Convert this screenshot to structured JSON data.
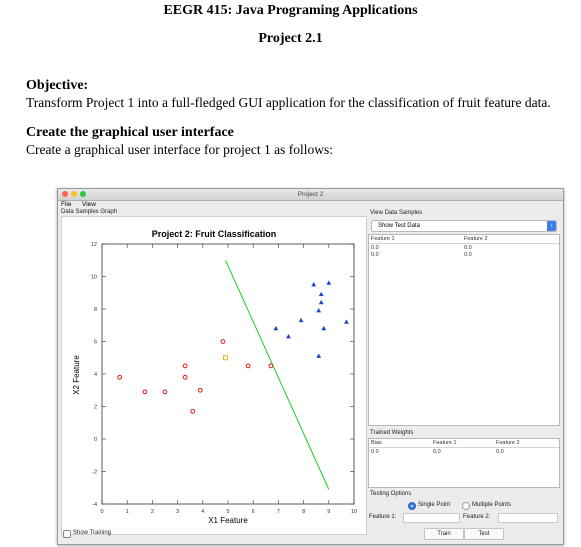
{
  "document": {
    "course_title": "EEGR 415: Java Programing Applications",
    "project_title": "Project 2.1",
    "objective_heading": "Objective:",
    "objective_text": "Transform Project 1 into a full-fledged GUI application for the classification of fruit feature data.",
    "gui_heading": "Create the graphical user interface",
    "gui_text": "Create a graphical user interface for project 1 as follows:"
  },
  "window": {
    "title": "Project 2",
    "menus": [
      "File",
      "View"
    ],
    "traffic_light_colors": [
      "#ff5f57",
      "#febc2e",
      "#28c840"
    ],
    "graph_panel_label": "Data Samples Graph",
    "view_panel_label": "View Data Samples",
    "view_select_value": "Show Test Data",
    "samples_table": {
      "headers": [
        "Feature 1",
        "Feature 2"
      ],
      "rows": [
        [
          "0.0",
          "0.0"
        ],
        [
          "0.0",
          "0.0"
        ]
      ]
    },
    "weights_label": "Trained Weights",
    "weights_table": {
      "headers": [
        "Bias",
        "Feature 1",
        "Feature 2"
      ],
      "rows": [
        [
          "0.0",
          "0.0",
          "0.0"
        ]
      ]
    },
    "testing_label": "Testing Options",
    "radio_single": "Single Point",
    "radio_multiple": "Multiple Points",
    "feature1_label": "Feature 1:",
    "feature2_label": "Feature 2:",
    "train_button": "Train",
    "test_button": "Test",
    "show_training_label": "Show Training"
  },
  "chart_data": {
    "type": "scatter",
    "title": "Project 2: Fruit Classification",
    "xlabel": "X1 Feature",
    "ylabel": "X2 Feature",
    "xlim": [
      0,
      10
    ],
    "ylim": [
      -4,
      12
    ],
    "xticks": [
      "0",
      "1",
      "2",
      "3",
      "4",
      "5",
      "6",
      "7",
      "8",
      "9",
      "10"
    ],
    "yticks": [
      "-4",
      "-2",
      "0",
      "2",
      "4",
      "6",
      "8",
      "10",
      "12"
    ],
    "series": [
      {
        "marker": "circle",
        "color": "#e02020",
        "points": [
          [
            0.7,
            3.8
          ],
          [
            1.7,
            2.9
          ],
          [
            2.5,
            2.9
          ],
          [
            3.3,
            4.5
          ],
          [
            3.3,
            3.8
          ],
          [
            3.6,
            1.7
          ],
          [
            3.9,
            3.0
          ],
          [
            4.8,
            6.0
          ],
          [
            5.8,
            4.5
          ],
          [
            6.7,
            4.5
          ]
        ]
      },
      {
        "marker": "square",
        "color": "#f0b020",
        "points": [
          [
            4.9,
            5.0
          ]
        ]
      },
      {
        "marker": "triangle",
        "color": "#2040d0",
        "points": [
          [
            6.9,
            6.8
          ],
          [
            7.4,
            6.3
          ],
          [
            7.9,
            7.3
          ],
          [
            8.4,
            9.5
          ],
          [
            8.6,
            7.9
          ],
          [
            8.7,
            8.4
          ],
          [
            8.7,
            8.9
          ],
          [
            8.8,
            6.8
          ],
          [
            9.0,
            9.6
          ],
          [
            9.7,
            7.2
          ],
          [
            8.6,
            5.1
          ]
        ]
      }
    ],
    "decision_line": {
      "color": "#22cc22",
      "points": [
        [
          4.9,
          11.0
        ],
        [
          9.0,
          -3.1
        ]
      ]
    },
    "grid": false,
    "legend": "none"
  }
}
